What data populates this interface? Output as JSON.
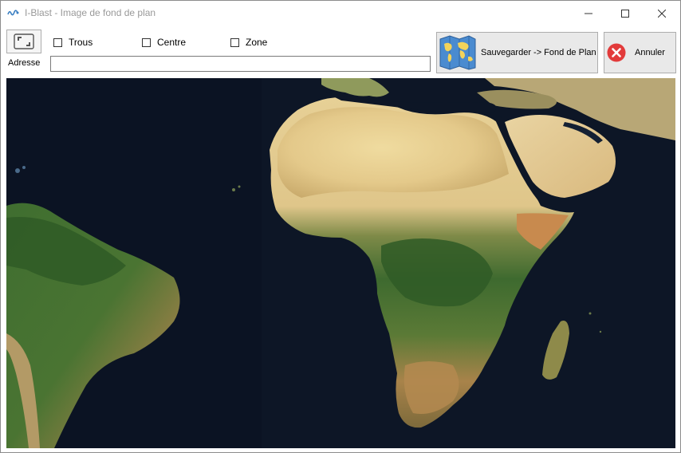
{
  "window": {
    "title": "I-Blast - Image de fond de plan",
    "controls": {
      "minimize_icon": "minimize-icon",
      "maximize_icon": "maximize-icon",
      "close_icon": "close-icon"
    }
  },
  "toolbar": {
    "fit_button_icon": "fit-frame-icon",
    "address_label": "Adresse",
    "address_value": "",
    "checkboxes": [
      {
        "label": "Trous",
        "checked": false
      },
      {
        "label": "Centre",
        "checked": false
      },
      {
        "label": "Zone",
        "checked": false
      }
    ],
    "save_button": {
      "label": "Sauvegarder -> Fond de Plan",
      "icon": "world-map-icon"
    },
    "cancel_button": {
      "label": "Annuler",
      "icon": "cancel-x-icon"
    }
  },
  "map": {
    "description_icon": "satellite-map-image",
    "colors": {
      "ocean": "#0d1626",
      "desert": "#e6cf8e",
      "forest": "#3f6b2e",
      "savanna": "#8a7a3c"
    }
  }
}
